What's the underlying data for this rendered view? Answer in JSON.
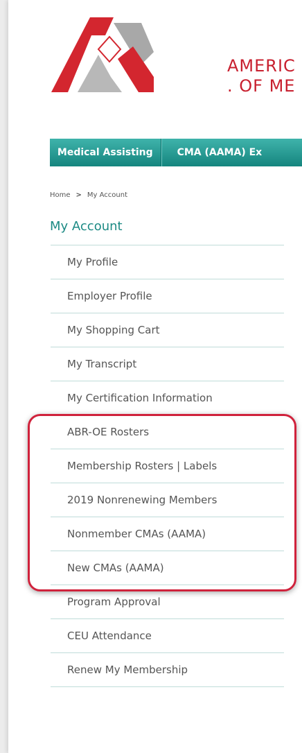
{
  "brand": {
    "org_line1": "AMERIC",
    "org_line2": ". OF ME",
    "colors": {
      "red": "#c8202f",
      "grey": "#a8a8a8",
      "teal": "#1c8a84"
    }
  },
  "nav": {
    "items": [
      {
        "label": "Medical Assisting"
      },
      {
        "label": "CMA (AAMA) Ex"
      }
    ]
  },
  "breadcrumb": {
    "home": "Home",
    "separator": ">",
    "current": "My Account"
  },
  "sidebar": {
    "title": "My Account",
    "items": [
      {
        "label": "My Profile"
      },
      {
        "label": "Employer Profile"
      },
      {
        "label": "My Shopping Cart"
      },
      {
        "label": "My Transcript"
      },
      {
        "label": "My Certification Information"
      },
      {
        "label": "ABR-OE Rosters"
      },
      {
        "label": "Membership Rosters | Labels"
      },
      {
        "label": "2019 Nonrenewing Members"
      },
      {
        "label": "Nonmember CMAs (AAMA)"
      },
      {
        "label": "New CMAs (AAMA)"
      },
      {
        "label": "Program Approval"
      },
      {
        "label": "CEU Attendance"
      },
      {
        "label": "Renew My Membership"
      }
    ]
  },
  "highlight_color": "#d0223c"
}
